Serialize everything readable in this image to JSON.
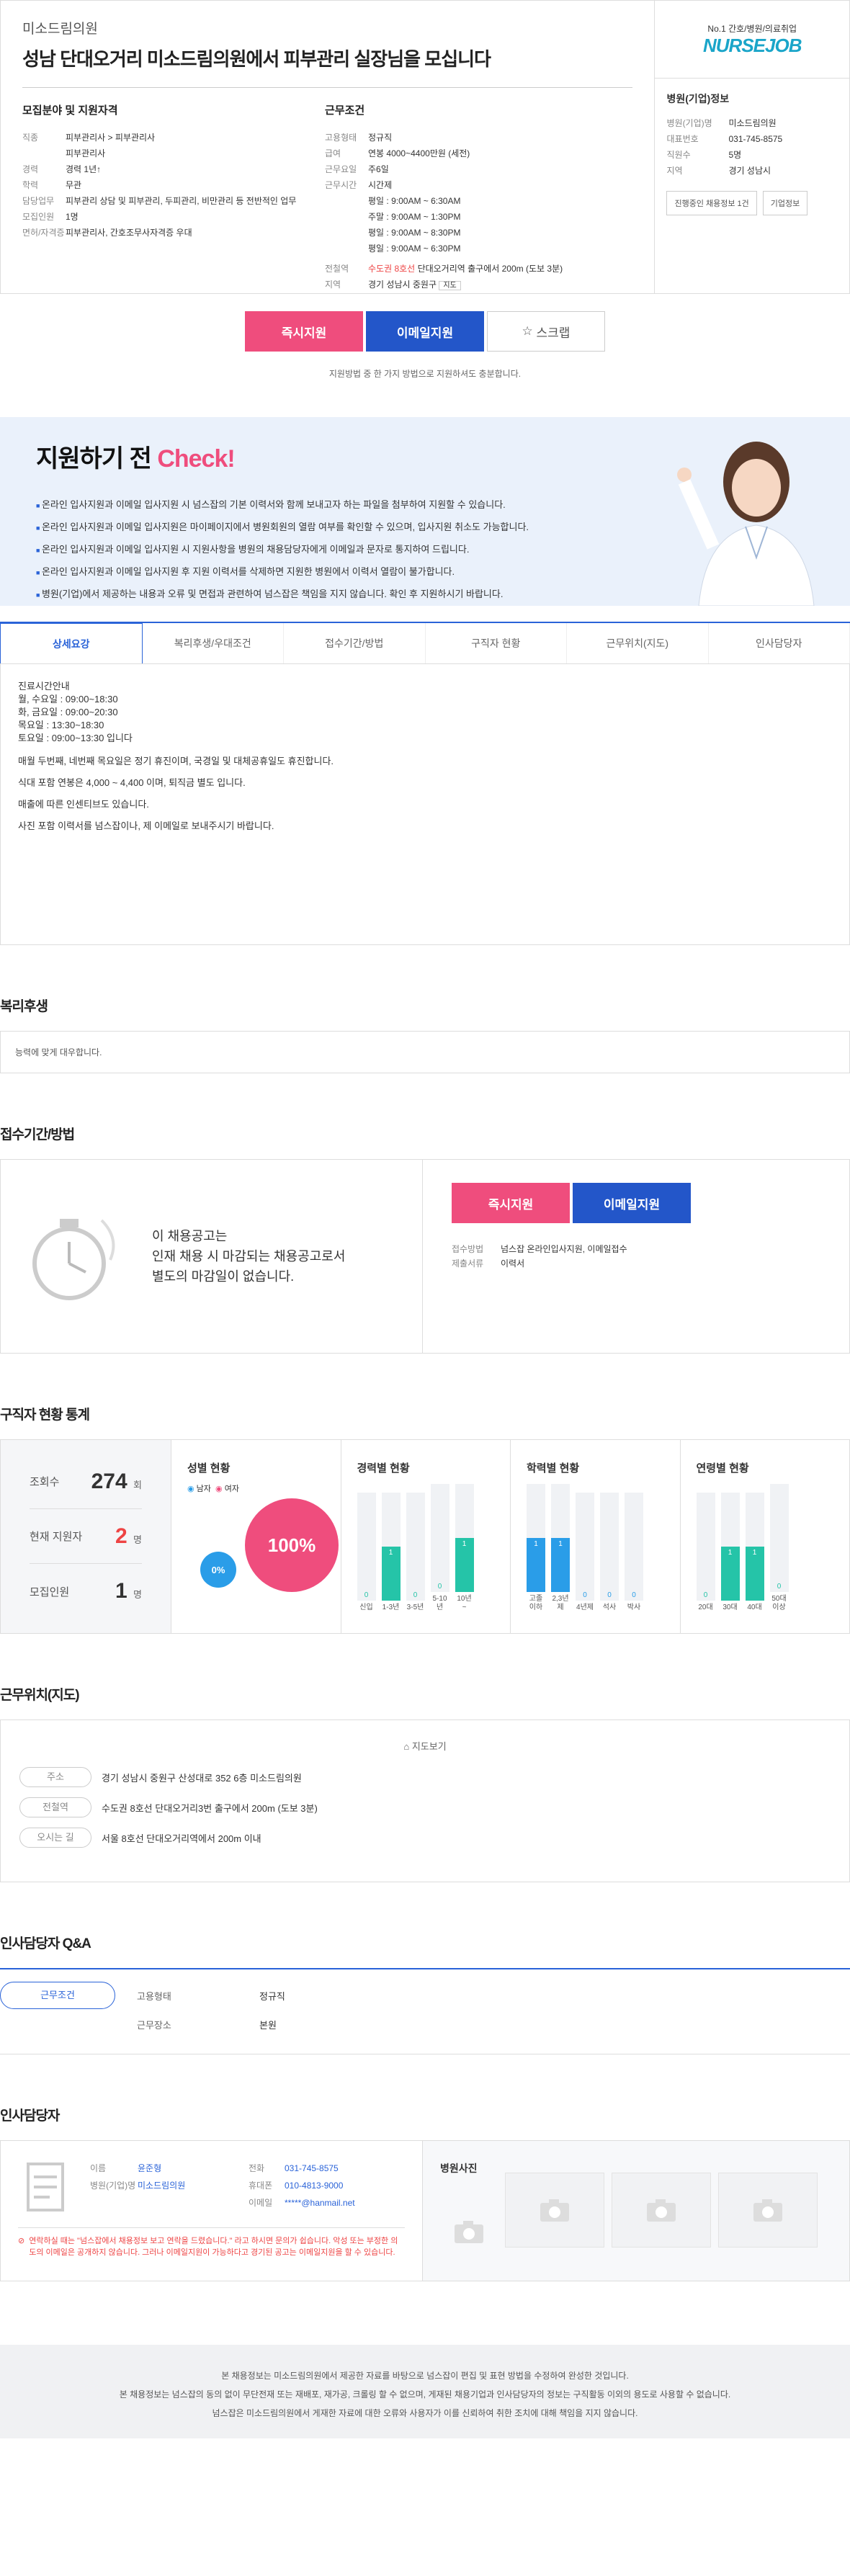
{
  "header": {
    "company": "미소드림의원",
    "title": "성남 단대오거리 미소드림의원에서 피부관리 실장님을 모십니다"
  },
  "req": {
    "title": "모집분야 및 지원자격",
    "rows": [
      {
        "k": "직종",
        "v": "피부관리사 > 피부관리사"
      },
      {
        "k": "",
        "v": "피부관리사"
      },
      {
        "k": "경력",
        "v": "경력 1년↑"
      },
      {
        "k": "학력",
        "v": "무관"
      },
      {
        "k": "담당업무",
        "v": "피부관리 상담 및 피부관리, 두피관리, 비만관리 등 전반적인 업무"
      },
      {
        "k": "모집인원",
        "v": "1명"
      },
      {
        "k": "면허/자격증",
        "v": "피부관리사, 간호조무사자격증 우대"
      }
    ]
  },
  "cond": {
    "title": "근무조건",
    "rows": [
      {
        "k": "고용형태",
        "v": "정규직"
      },
      {
        "k": "급여",
        "v": "연봉 4000~4400만원 (세전)"
      },
      {
        "k": "근무요일",
        "v": "주6일"
      },
      {
        "k": "근무시간",
        "v": "시간제"
      },
      {
        "k": "",
        "v": "평일 : 9:00AM ~ 6:30AM"
      },
      {
        "k": "",
        "v": "주말 : 9:00AM ~ 1:30PM"
      },
      {
        "k": "",
        "v": "평일 : 9:00AM ~ 8:30PM"
      },
      {
        "k": "",
        "v": "평일 : 9:00AM ~ 6:30PM"
      }
    ],
    "station_k": "전철역",
    "station_line": "수도권 8호선",
    "station_v": "단대오거리역 출구에서 200m (도보 3분)",
    "area_k": "지역",
    "area_v": "경기 성남시 중원구",
    "map_btn": "지도"
  },
  "side": {
    "slogan": "No.1 간호/병원/의료취업",
    "logo": "NURSEJOB",
    "info_title": "병원(기업)정보",
    "rows": [
      {
        "k": "병원(기업)명",
        "v": "미소드림의원"
      },
      {
        "k": "대표번호",
        "v": "031-745-8575"
      },
      {
        "k": "직원수",
        "v": "5명"
      },
      {
        "k": "지역",
        "v": "경기 성남시"
      }
    ],
    "btn1": "진행중인 채용정보 1건",
    "btn2": "기업정보"
  },
  "apply": {
    "now": "즉시지원",
    "email": "이메일지원",
    "scrap": "스크랩",
    "note": "지원방법 중 한 가지 방법으로 지원하셔도 충분합니다."
  },
  "check": {
    "title1": "지원하기 전",
    "title2": "Check!",
    "items": [
      "온라인 입사지원과 이메일 입사지원 시 넘스잡의 기본 이력서와 함께 보내고자 하는 파일을 첨부하여 지원할 수 있습니다.",
      "온라인 입사지원과 이메일 입사지원은 마이페이지에서 병원회원의 열람 여부를 확인할 수 있으며, 입사지원 취소도 가능합니다.",
      "온라인 입사지원과 이메일 입사지원 시 지원사항을 병원의 채용담당자에게 이메일과 문자로 통지하여 드립니다.",
      "온라인 입사지원과 이메일 입사지원 후 지원 이력서를 삭제하면 지원한 병원에서 이력서 열람이 불가합니다.",
      "병원(기업)에서 제공하는 내용과 오류 및 면접과 관련하여 넘스잡은 책임을 지지 않습니다. 확인 후 지원하시기 바랍니다."
    ]
  },
  "tabs": [
    "상세요강",
    "복리후생/우대조건",
    "접수기간/방법",
    "구직자 현황",
    "근무위치(지도)",
    "인사담당자"
  ],
  "detail": [
    "진료시간안내",
    "월, 수요일 : 09:00~18:30",
    "화, 금요일 : 09:00~20:30",
    "목요일 : 13:30~18:30",
    "토요일 : 09:00~13:30 입니다",
    "매월 두번째, 네번째 목요일은 정기 휴진이며, 국경일 및 대체공휴일도 휴진합니다.",
    "식대 포함 연봉은 4,000 ~ 4,400 이며, 퇴직금 별도 입니다.",
    "매출에 따른 인센티브도 있습니다.",
    "사진 포함 이력서를 넘스잡이나, 제 이메일로 보내주시기 바랍니다."
  ],
  "welfare": {
    "title": "복리후생",
    "text": "능력에 맞게 대우합니다."
  },
  "period": {
    "title": "접수기간/방법",
    "text1": "이 채용공고는",
    "text2": "인재 채용 시 마감되는 채용공고로서",
    "text3": "별도의 마감일이 없습니다.",
    "k1": "접수방법",
    "v1": "넘스잡 온라인입사지원, 이메일접수",
    "k2": "제출서류",
    "v2": "이력서"
  },
  "stats": {
    "title": "구직자 현황 통계",
    "views_k": "조회수",
    "views": "274",
    "views_u": "회",
    "apps_k": "현재 지원자",
    "apps": "2",
    "apps_u": "명",
    "quota_k": "모집인원",
    "quota": "1",
    "quota_u": "명",
    "gender_title": "성별 현황",
    "male": "남자",
    "female": "여자",
    "male_pct": "0%",
    "female_pct": "100%",
    "exp_title": "경력별 현황",
    "edu_title": "학력별 현황",
    "age_title": "연령별 현황"
  },
  "chart_data": [
    {
      "type": "bar",
      "title": "경력별 현황",
      "categories": [
        "신입",
        "1-3년",
        "3-5년",
        "5-10년",
        "10년~"
      ],
      "values": [
        0,
        1,
        0,
        0,
        1
      ],
      "ylim": [
        0,
        2
      ]
    },
    {
      "type": "bar",
      "title": "학력별 현황",
      "categories": [
        "고졸이하",
        "2,3년제",
        "4년제",
        "석사",
        "박사"
      ],
      "values": [
        1,
        1,
        0,
        0,
        0
      ],
      "ylim": [
        0,
        2
      ]
    },
    {
      "type": "bar",
      "title": "연령별 현황",
      "categories": [
        "20대",
        "30대",
        "40대",
        "50대이상"
      ],
      "values": [
        0,
        1,
        1,
        0
      ],
      "ylim": [
        0,
        2
      ]
    },
    {
      "type": "pie",
      "title": "성별 현황",
      "categories": [
        "남자",
        "여자"
      ],
      "values": [
        0,
        100
      ]
    }
  ],
  "map": {
    "title": "근무위치(지도)",
    "view": "지도보기",
    "k1": "주소",
    "v1": "경기 성남시 중원구 산성대로 352 6층 미소드림의원",
    "k2": "전철역",
    "v2": "수도권 8호선 단대오거리3번 출구에서 200m (도보 3분)",
    "k3": "오시는 길",
    "v3": "서울 8호선 단대오거리역에서 200m 이내"
  },
  "qa": {
    "title": "인사담당자 Q&A",
    "tab": "근무조건",
    "k1": "고용형태",
    "v1": "정규직",
    "k2": "근무장소",
    "v2": "본원"
  },
  "mgr": {
    "title": "인사담당자",
    "name_k": "이름",
    "name": "윤준형",
    "co_k": "병원(기업)명",
    "co": "미소드림의원",
    "tel_k": "전화",
    "tel": "031-745-8575",
    "mob_k": "휴대폰",
    "mob": "010-4813-9000",
    "mail_k": "이메일",
    "mail": "*****@hanmail.net",
    "warn": "연락하실 때는 \"넘스잡에서 채용정보 보고 연락을 드렸습니다.\" 라고 하시면 문의가 쉽습니다. 악성 또는 부정한 의도의 이메일은 공개하지 않습니다. 그러나 이메일지원이 가능하다고 경기된 공고는 이메일지원을 할 수 있습니다.",
    "photo_title": "병원사진"
  },
  "footer": {
    "l1": "본 채용정보는 미소드림의원에서 제공한 자료를 바탕으로 넘스잡이 편집 및 표현 방법을 수정하여 완성한 것입니다.",
    "l2": "본 채용정보는 넘스잡의 동의 없이 무단전재 또는 재배포, 재가공, 크롤링 할 수 없으며, 게재된 채용기업과 인사담당자의 정보는 구직활동 이외의 용도로 사용할 수 없습니다.",
    "l3": "넘스잡은 미소드림의원에서 게재한 자료에 대한 오류와 사용자가 이를 신뢰하여 취한 조치에 대해 책임을 지지 않습니다."
  }
}
